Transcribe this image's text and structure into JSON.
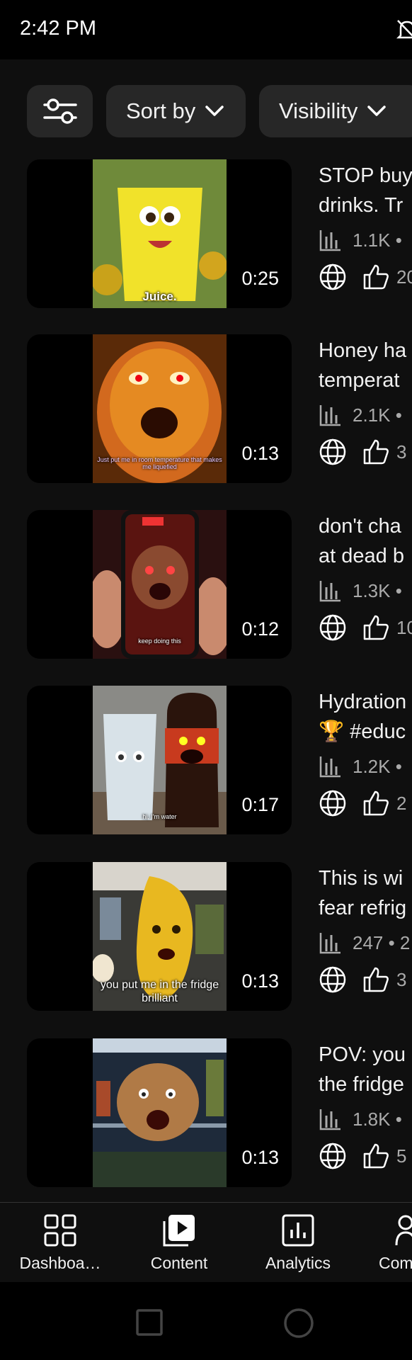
{
  "status_bar": {
    "time": "2:42 PM",
    "notification_icon": "bell-off-icon"
  },
  "filters": {
    "tune_icon": "tune-icon",
    "sort_label": "Sort by",
    "visibility_label": "Visibility"
  },
  "videos": [
    {
      "title_line1": "STOP buy",
      "title_line2": "drinks. Tr",
      "views": "1.1K •",
      "likes": "20",
      "duration": "0:25",
      "thumb_caption": "Juice."
    },
    {
      "title_line1": "Honey ha",
      "title_line2": "temperat",
      "views": "2.1K •",
      "likes": "3",
      "duration": "0:13",
      "thumb_caption": "Just put me in room temperature that makes me liquefied"
    },
    {
      "title_line1": "don't cha",
      "title_line2": "at dead b",
      "views": "1.3K •",
      "likes": "10",
      "duration": "0:12",
      "thumb_caption": "keep doing this"
    },
    {
      "title_line1": "Hydration",
      "title_line2": "🏆 #educ",
      "views": "1.2K •",
      "likes": "2",
      "duration": "0:17",
      "thumb_caption": "hi, I'm water"
    },
    {
      "title_line1": "This is wi",
      "title_line2": "fear refrig",
      "views": "247 • 2",
      "likes": "3",
      "duration": "0:13",
      "thumb_caption": "you put me in the fridge brilliant"
    },
    {
      "title_line1": "POV: you",
      "title_line2": "the fridge",
      "views": "1.8K •",
      "likes": "5",
      "duration": "0:13",
      "thumb_caption": ""
    }
  ],
  "nav": {
    "dashboard": "Dashboa…",
    "content": "Content",
    "analytics": "Analytics",
    "community": "Com"
  },
  "colors": {
    "background": "#0f0f0f",
    "chip": "#272727",
    "secondary_text": "#aaaaaa"
  }
}
